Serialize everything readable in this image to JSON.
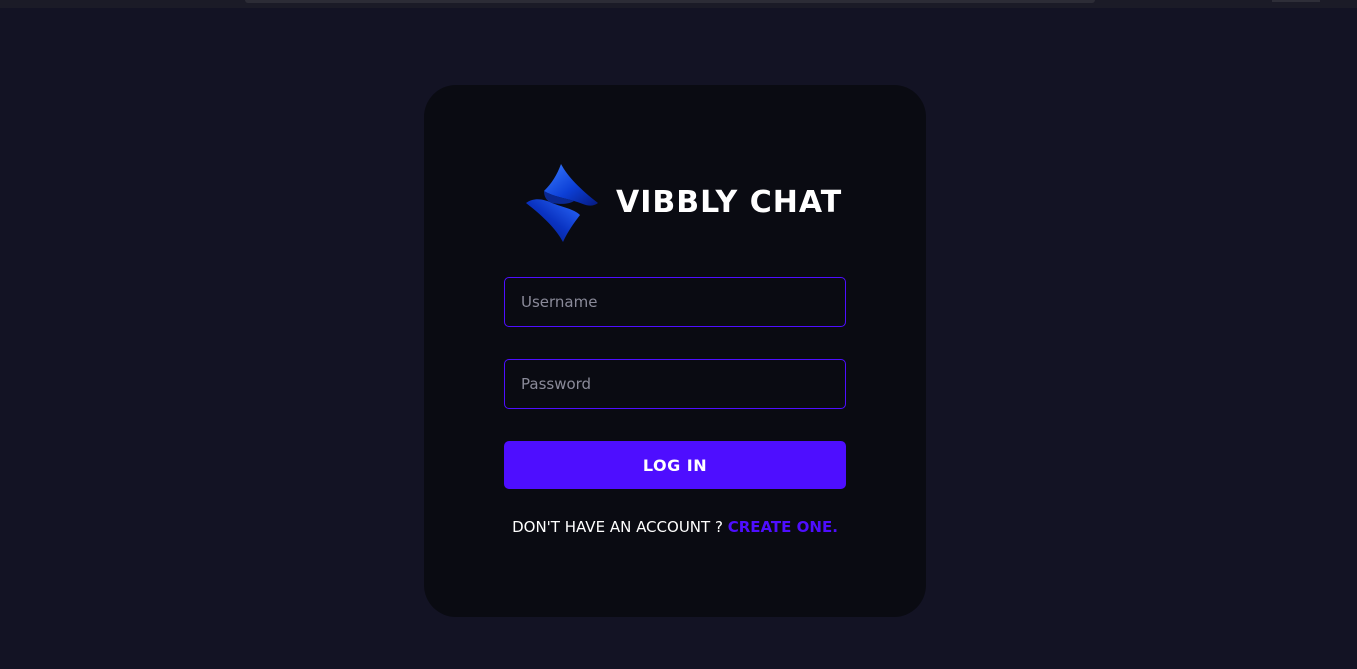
{
  "brand": {
    "name": "VIBBLY CHAT",
    "logo_icon": "vibbly-logo-icon"
  },
  "form": {
    "username_placeholder": "Username",
    "password_placeholder": "Password",
    "login_label": "LOG IN",
    "signup_prompt": "DON'T HAVE AN ACCOUNT ? ",
    "signup_link": "CREATE ONE."
  },
  "colors": {
    "page_bg": "#131324",
    "card_bg": "#0a0b12",
    "accent": "#4e0eff",
    "text": "#ffffff"
  }
}
